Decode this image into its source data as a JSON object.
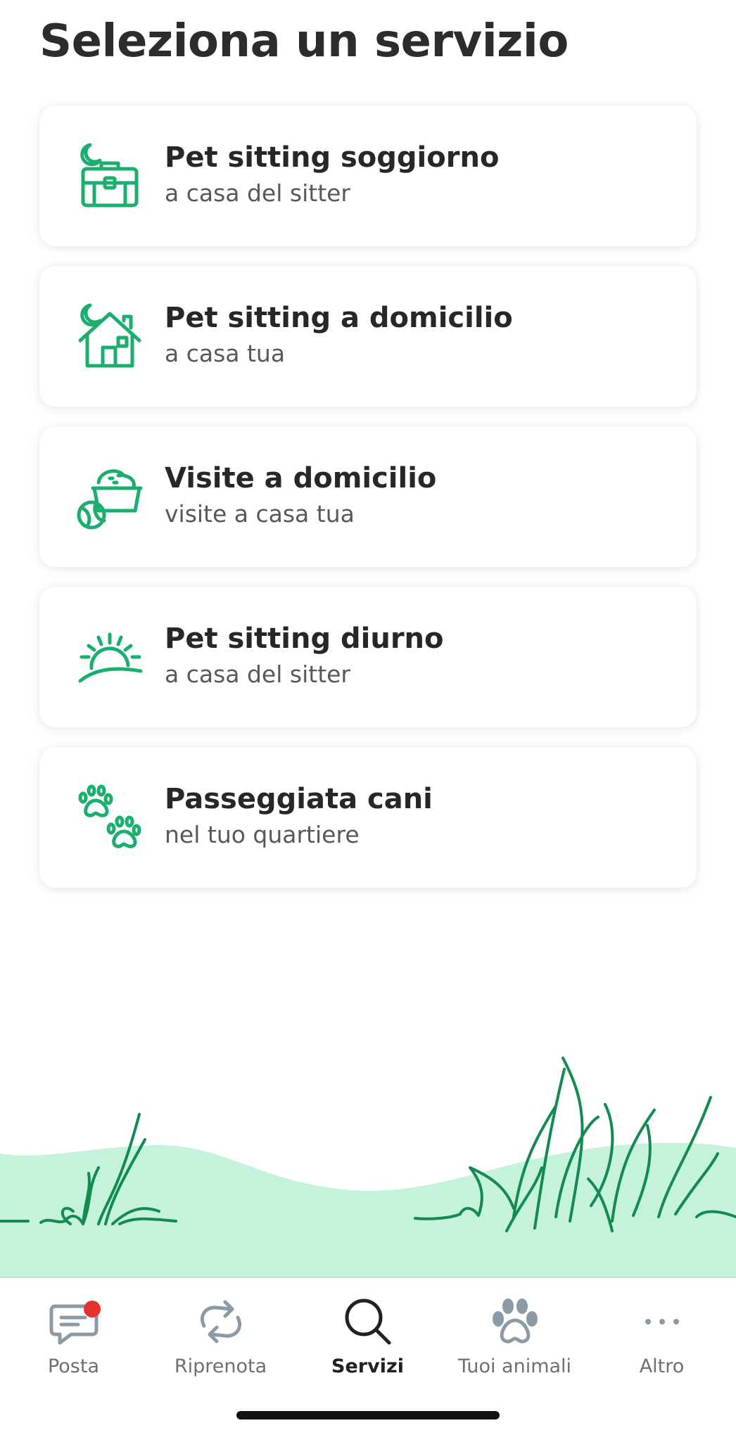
{
  "page": {
    "title": "Seleziona un servizio"
  },
  "colors": {
    "accent": "#1aae6f",
    "grass_dark": "#138a50",
    "grass_light": "#c4f2da",
    "tab_inactive": "#8a9aa6",
    "notification": "#e5312f"
  },
  "services": [
    {
      "icon": "suitcase-moon-icon",
      "title": "Pet sitting soggiorno",
      "subtitle": "a casa del sitter"
    },
    {
      "icon": "house-moon-icon",
      "title": "Pet sitting a domicilio",
      "subtitle": "a casa tua"
    },
    {
      "icon": "food-bowl-ball-icon",
      "title": "Visite a domicilio",
      "subtitle": "visite a casa tua"
    },
    {
      "icon": "sunrise-icon",
      "title": "Pet sitting diurno",
      "subtitle": "a casa del sitter"
    },
    {
      "icon": "paw-prints-icon",
      "title": "Passeggiata cani",
      "subtitle": "nel tuo quartiere"
    }
  ],
  "tabbar": {
    "tabs": [
      {
        "icon": "chat-bubble-icon",
        "label": "Posta",
        "active": false,
        "has_notification": true
      },
      {
        "icon": "repeat-arrows-icon",
        "label": "Riprenota",
        "active": false
      },
      {
        "icon": "search-icon",
        "label": "Servizi",
        "active": true
      },
      {
        "icon": "paw-icon",
        "label": "Tuoi animali",
        "active": false
      },
      {
        "icon": "more-dots-icon",
        "label": "Altro",
        "active": false
      }
    ]
  }
}
